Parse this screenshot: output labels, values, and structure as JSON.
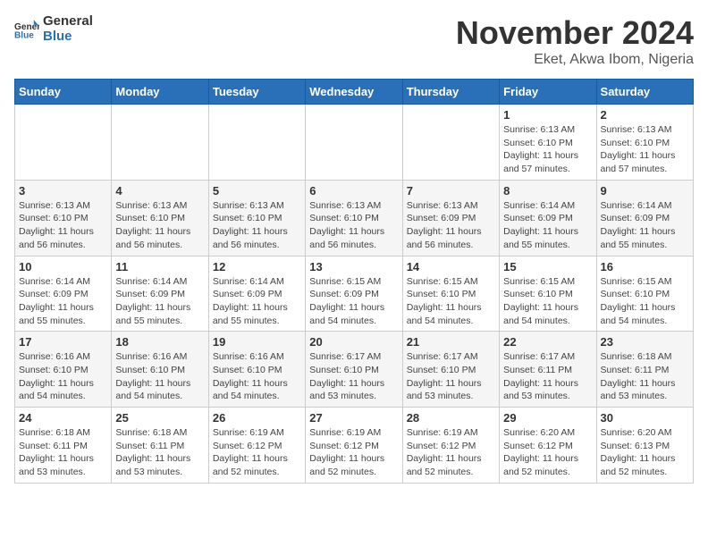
{
  "header": {
    "logo_line1": "General",
    "logo_line2": "Blue",
    "title": "November 2024",
    "subtitle": "Eket, Akwa Ibom, Nigeria"
  },
  "days_of_week": [
    "Sunday",
    "Monday",
    "Tuesday",
    "Wednesday",
    "Thursday",
    "Friday",
    "Saturday"
  ],
  "weeks": [
    [
      {
        "day": "",
        "detail": ""
      },
      {
        "day": "",
        "detail": ""
      },
      {
        "day": "",
        "detail": ""
      },
      {
        "day": "",
        "detail": ""
      },
      {
        "day": "",
        "detail": ""
      },
      {
        "day": "1",
        "detail": "Sunrise: 6:13 AM\nSunset: 6:10 PM\nDaylight: 11 hours and 57 minutes."
      },
      {
        "day": "2",
        "detail": "Sunrise: 6:13 AM\nSunset: 6:10 PM\nDaylight: 11 hours and 57 minutes."
      }
    ],
    [
      {
        "day": "3",
        "detail": "Sunrise: 6:13 AM\nSunset: 6:10 PM\nDaylight: 11 hours and 56 minutes."
      },
      {
        "day": "4",
        "detail": "Sunrise: 6:13 AM\nSunset: 6:10 PM\nDaylight: 11 hours and 56 minutes."
      },
      {
        "day": "5",
        "detail": "Sunrise: 6:13 AM\nSunset: 6:10 PM\nDaylight: 11 hours and 56 minutes."
      },
      {
        "day": "6",
        "detail": "Sunrise: 6:13 AM\nSunset: 6:10 PM\nDaylight: 11 hours and 56 minutes."
      },
      {
        "day": "7",
        "detail": "Sunrise: 6:13 AM\nSunset: 6:09 PM\nDaylight: 11 hours and 56 minutes."
      },
      {
        "day": "8",
        "detail": "Sunrise: 6:14 AM\nSunset: 6:09 PM\nDaylight: 11 hours and 55 minutes."
      },
      {
        "day": "9",
        "detail": "Sunrise: 6:14 AM\nSunset: 6:09 PM\nDaylight: 11 hours and 55 minutes."
      }
    ],
    [
      {
        "day": "10",
        "detail": "Sunrise: 6:14 AM\nSunset: 6:09 PM\nDaylight: 11 hours and 55 minutes."
      },
      {
        "day": "11",
        "detail": "Sunrise: 6:14 AM\nSunset: 6:09 PM\nDaylight: 11 hours and 55 minutes."
      },
      {
        "day": "12",
        "detail": "Sunrise: 6:14 AM\nSunset: 6:09 PM\nDaylight: 11 hours and 55 minutes."
      },
      {
        "day": "13",
        "detail": "Sunrise: 6:15 AM\nSunset: 6:09 PM\nDaylight: 11 hours and 54 minutes."
      },
      {
        "day": "14",
        "detail": "Sunrise: 6:15 AM\nSunset: 6:10 PM\nDaylight: 11 hours and 54 minutes."
      },
      {
        "day": "15",
        "detail": "Sunrise: 6:15 AM\nSunset: 6:10 PM\nDaylight: 11 hours and 54 minutes."
      },
      {
        "day": "16",
        "detail": "Sunrise: 6:15 AM\nSunset: 6:10 PM\nDaylight: 11 hours and 54 minutes."
      }
    ],
    [
      {
        "day": "17",
        "detail": "Sunrise: 6:16 AM\nSunset: 6:10 PM\nDaylight: 11 hours and 54 minutes."
      },
      {
        "day": "18",
        "detail": "Sunrise: 6:16 AM\nSunset: 6:10 PM\nDaylight: 11 hours and 54 minutes."
      },
      {
        "day": "19",
        "detail": "Sunrise: 6:16 AM\nSunset: 6:10 PM\nDaylight: 11 hours and 54 minutes."
      },
      {
        "day": "20",
        "detail": "Sunrise: 6:17 AM\nSunset: 6:10 PM\nDaylight: 11 hours and 53 minutes."
      },
      {
        "day": "21",
        "detail": "Sunrise: 6:17 AM\nSunset: 6:10 PM\nDaylight: 11 hours and 53 minutes."
      },
      {
        "day": "22",
        "detail": "Sunrise: 6:17 AM\nSunset: 6:11 PM\nDaylight: 11 hours and 53 minutes."
      },
      {
        "day": "23",
        "detail": "Sunrise: 6:18 AM\nSunset: 6:11 PM\nDaylight: 11 hours and 53 minutes."
      }
    ],
    [
      {
        "day": "24",
        "detail": "Sunrise: 6:18 AM\nSunset: 6:11 PM\nDaylight: 11 hours and 53 minutes."
      },
      {
        "day": "25",
        "detail": "Sunrise: 6:18 AM\nSunset: 6:11 PM\nDaylight: 11 hours and 53 minutes."
      },
      {
        "day": "26",
        "detail": "Sunrise: 6:19 AM\nSunset: 6:12 PM\nDaylight: 11 hours and 52 minutes."
      },
      {
        "day": "27",
        "detail": "Sunrise: 6:19 AM\nSunset: 6:12 PM\nDaylight: 11 hours and 52 minutes."
      },
      {
        "day": "28",
        "detail": "Sunrise: 6:19 AM\nSunset: 6:12 PM\nDaylight: 11 hours and 52 minutes."
      },
      {
        "day": "29",
        "detail": "Sunrise: 6:20 AM\nSunset: 6:12 PM\nDaylight: 11 hours and 52 minutes."
      },
      {
        "day": "30",
        "detail": "Sunrise: 6:20 AM\nSunset: 6:13 PM\nDaylight: 11 hours and 52 minutes."
      }
    ]
  ]
}
